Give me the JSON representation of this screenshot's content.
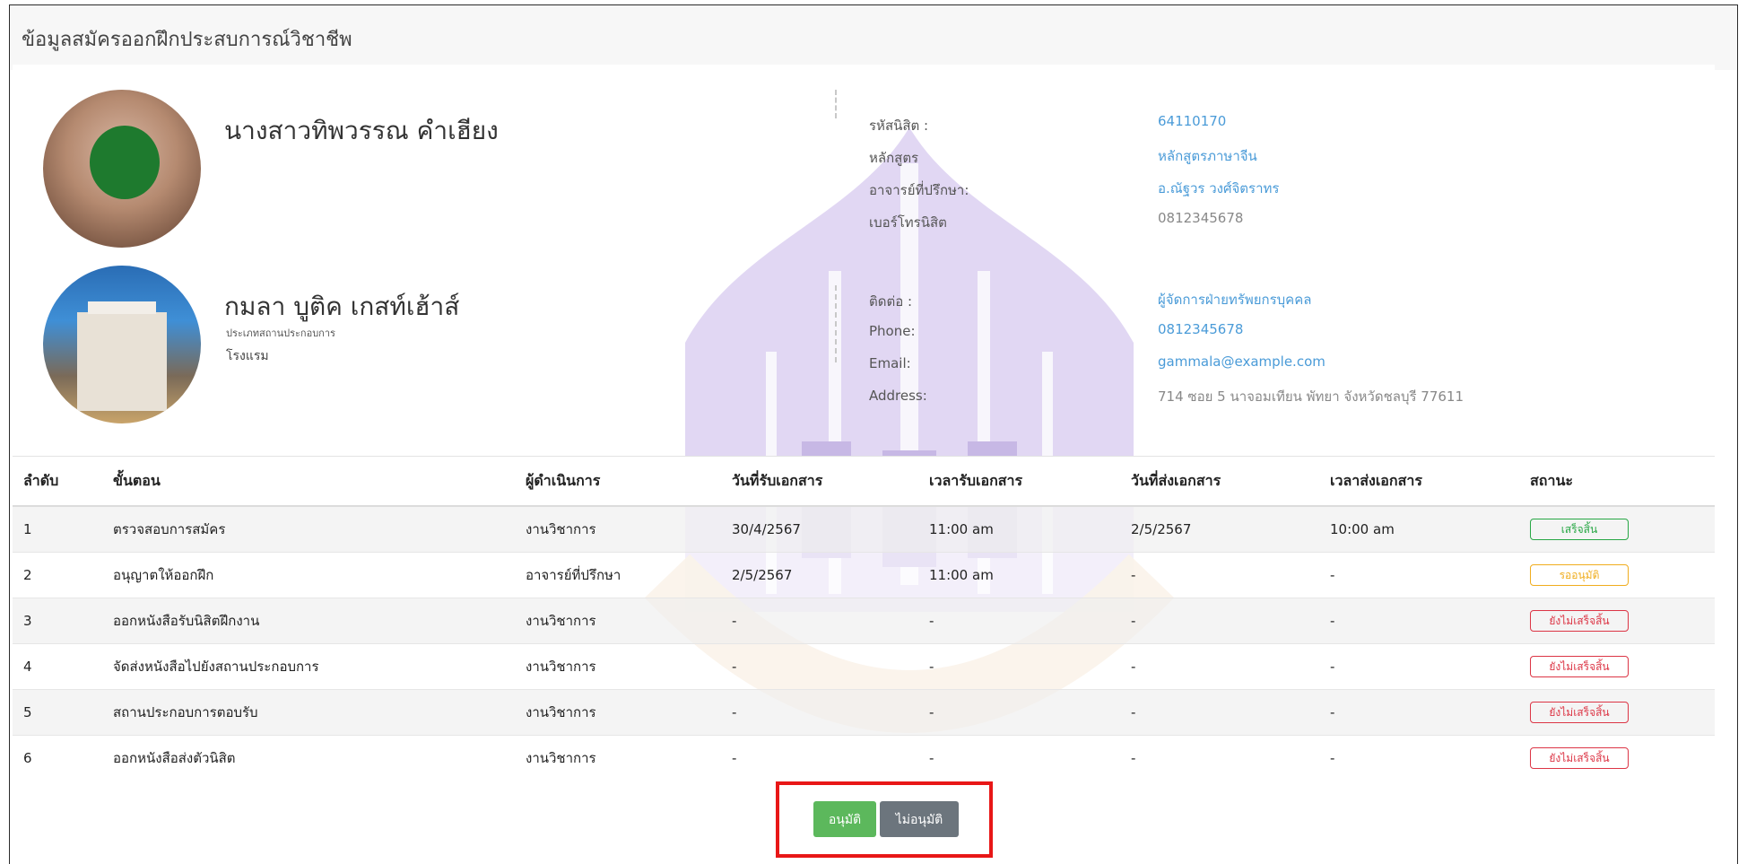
{
  "page": {
    "title": "ข้อมูลสมัครออกฝึกประสบการณ์วิชาชีพ"
  },
  "student": {
    "name": "นางสาวทิพวรรณ คำเฮียง",
    "fields": [
      {
        "label": "รหัสนิสิต :",
        "value": "64110170"
      },
      {
        "label": "หลักสูตร",
        "value": "หลักสูตรภาษาจีน"
      },
      {
        "label": "อาจารย์ที่ปรึกษา:",
        "value": "อ.ณัฐวร วงศ์จิตราทร"
      },
      {
        "label": "เบอร์โทรนิสิต",
        "value": "0812345678"
      }
    ]
  },
  "company": {
    "name": "กมลา บูติค เกสท์เฮ้าส์",
    "type_label": "ประเภทสถานประกอบการ",
    "type_value": "โรงแรม",
    "fields": [
      {
        "label": "ติดต่อ :",
        "value": "ผู้จัดการฝ่ายทรัพยกรบุคคล"
      },
      {
        "label": "Phone:",
        "value": "0812345678"
      },
      {
        "label": "Email:",
        "value": "gammala@example.com"
      },
      {
        "label": "Address:",
        "value": "714 ซอย 5 นาจอมเทียน พัทยา จังหวัดชลบุรี 77611"
      }
    ]
  },
  "table": {
    "headers": [
      "ลำดับ",
      "ขั้นตอน",
      "ผู้ดำเนินการ",
      "วันที่รับเอกสาร",
      "เวลารับเอกสาร",
      "วันที่ส่งเอกสาร",
      "เวลาส่งเอกสาร",
      "สถานะ"
    ],
    "rows": [
      {
        "no": "1",
        "step": "ตรวจสอบการสมัคร",
        "operator": "งานวิชาการ",
        "recv_date": "30/4/2567",
        "recv_time": "11:00 am",
        "send_date": "2/5/2567",
        "send_time": "10:00 am",
        "status": "เสร็จสิ้น"
      },
      {
        "no": "2",
        "step": "อนุญาตให้ออกฝึก",
        "operator": "อาจารย์ที่ปรึกษา",
        "recv_date": "2/5/2567",
        "recv_time": "11:00 am",
        "send_date": "-",
        "send_time": "-",
        "status": "รออนุมัติ"
      },
      {
        "no": "3",
        "step": "ออกหนังสือรับนิสิตฝึกงาน",
        "operator": "งานวิชาการ",
        "recv_date": "-",
        "recv_time": "-",
        "send_date": "-",
        "send_time": "-",
        "status": "ยังไม่เสร็จสิ้น"
      },
      {
        "no": "4",
        "step": "จัดส่งหนังสือไปยังสถานประกอบการ",
        "operator": "งานวิชาการ",
        "recv_date": "-",
        "recv_time": "-",
        "send_date": "-",
        "send_time": "-",
        "status": "ยังไม่เสร็จสิ้น"
      },
      {
        "no": "5",
        "step": "สถานประกอบการตอบรับ",
        "operator": "งานวิชาการ",
        "recv_date": "-",
        "recv_time": "-",
        "send_date": "-",
        "send_time": "-",
        "status": "ยังไม่เสร็จสิ้น"
      },
      {
        "no": "6",
        "step": "ออกหนังสือส่งตัวนิสิต",
        "operator": "งานวิชาการ",
        "recv_date": "-",
        "recv_time": "-",
        "send_date": "-",
        "send_time": "-",
        "status": "ยังไม่เสร็จสิ้น"
      }
    ]
  },
  "actions": {
    "approve_label": "อนุมัติ",
    "reject_label": "ไม่อนุมัติ"
  },
  "colors": {
    "accent_blue": "#4a9bd8",
    "done": "#28a745",
    "waiting": "#f0ad1e",
    "not_done": "#dc3545",
    "watermark": "#9b7fd0"
  }
}
